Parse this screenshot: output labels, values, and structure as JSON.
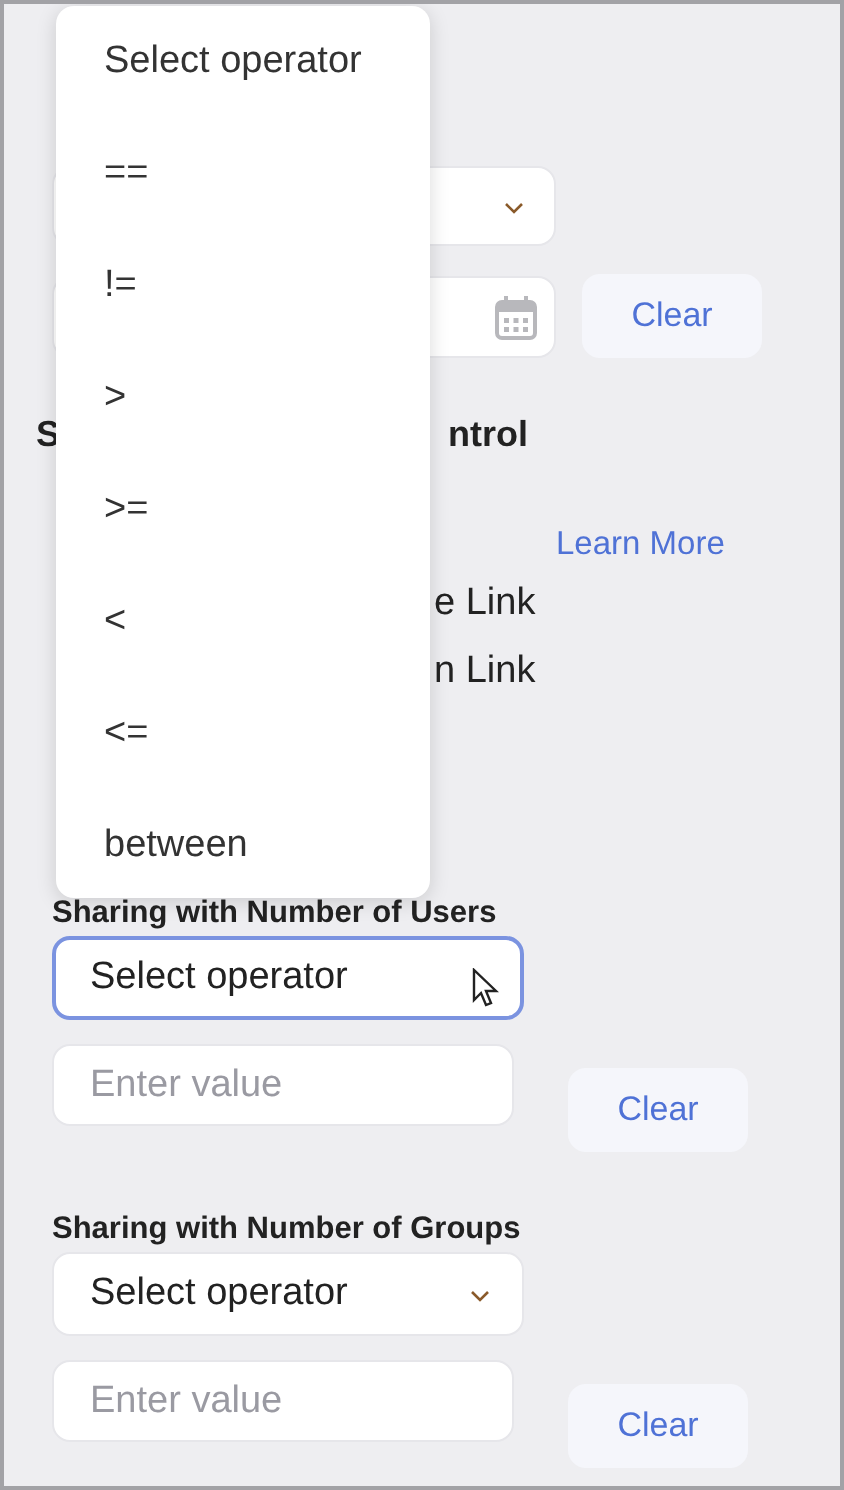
{
  "filter_top": {
    "operator_select": {
      "expanded": false
    },
    "clear_button": "Clear"
  },
  "section": {
    "heading_parts": [
      "S",
      "ntrol"
    ],
    "learn_more": "Learn More",
    "options": [
      "e Link",
      "n Link"
    ]
  },
  "filters": [
    {
      "label": "Sharing with Number of Users",
      "operator": "Select operator",
      "focused": true,
      "value_placeholder": "Enter value",
      "clear_button": "Clear"
    },
    {
      "label": "Sharing with Number of Groups",
      "operator": "Select operator",
      "focused": false,
      "value_placeholder": "Enter value",
      "clear_button": "Clear"
    }
  ],
  "dropdown": {
    "options": [
      "Select operator",
      "==",
      "!=",
      ">",
      ">=",
      "<",
      "<=",
      "between"
    ]
  }
}
